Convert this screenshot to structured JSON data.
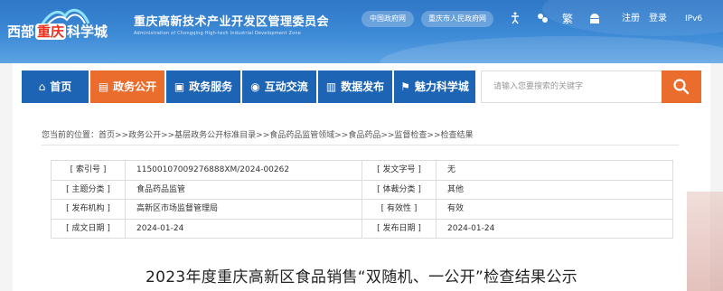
{
  "header": {
    "logo": {
      "prefix": "西部",
      "highlight": "重庆",
      "suffix": "科学城"
    },
    "org_name_cn": "重庆高新技术产业开发区管理委员会",
    "org_name_en": "Administration of Chongqing High-tech Industrial Development Zone",
    "links": {
      "china_gov": "中国政府网",
      "cq_gov": "重庆市人民政府网"
    },
    "icons": [
      "accessibility-icon",
      "care-mode-icon"
    ],
    "traditional": "繁",
    "android_icon": "android-icon",
    "register": "注册",
    "login": "登录",
    "ipv6": "IPv6"
  },
  "nav": {
    "items": [
      {
        "label": "首页",
        "icon": "home-icon",
        "glyph": "⌂"
      },
      {
        "label": "政务公开",
        "icon": "document-icon",
        "glyph": "▤",
        "active": true
      },
      {
        "label": "政务服务",
        "icon": "briefcase-icon",
        "glyph": "▣"
      },
      {
        "label": "互动交流",
        "icon": "chat-icon",
        "glyph": "◉"
      },
      {
        "label": "数据发布",
        "icon": "bar-chart-icon",
        "glyph": "▥"
      },
      {
        "label": "魅力科学城",
        "icon": "flag-icon",
        "glyph": "⚑"
      }
    ],
    "search_placeholder": "请输入您要搜索的关键字"
  },
  "breadcrumb": "您当前的位置：首页>>政务公开>>基层政务公开标准目录>>食品药品监管领域>>食品药品>>监督检查>>检查结果",
  "info": {
    "rows": [
      {
        "l1": "[ 索引号 ]",
        "v1": "11500107009276888XM/2024-00262",
        "l2": "[ 发文字号 ]",
        "v2": "无"
      },
      {
        "l1": "[ 主题分类 ]",
        "v1": "食品药品监管",
        "l2": "[ 体裁分类 ]",
        "v2": "其他"
      },
      {
        "l1": "[ 发布机构 ]",
        "v1": "高新区市场监督管理局",
        "l2": "[ 有效性 ]",
        "v2": "有效"
      },
      {
        "l1": "[ 成文日期 ]",
        "v1": "2024-01-24",
        "l2": "[ 发布日期 ]",
        "v2": "2024-01-24"
      }
    ]
  },
  "page_title": "2023年度重庆高新区食品销售“双随机、一公开”检查结果公示",
  "colors": {
    "nav_blue": "#1e64b4",
    "accent_orange": "#ea6d2d",
    "header_blue": "#2f77c7"
  }
}
